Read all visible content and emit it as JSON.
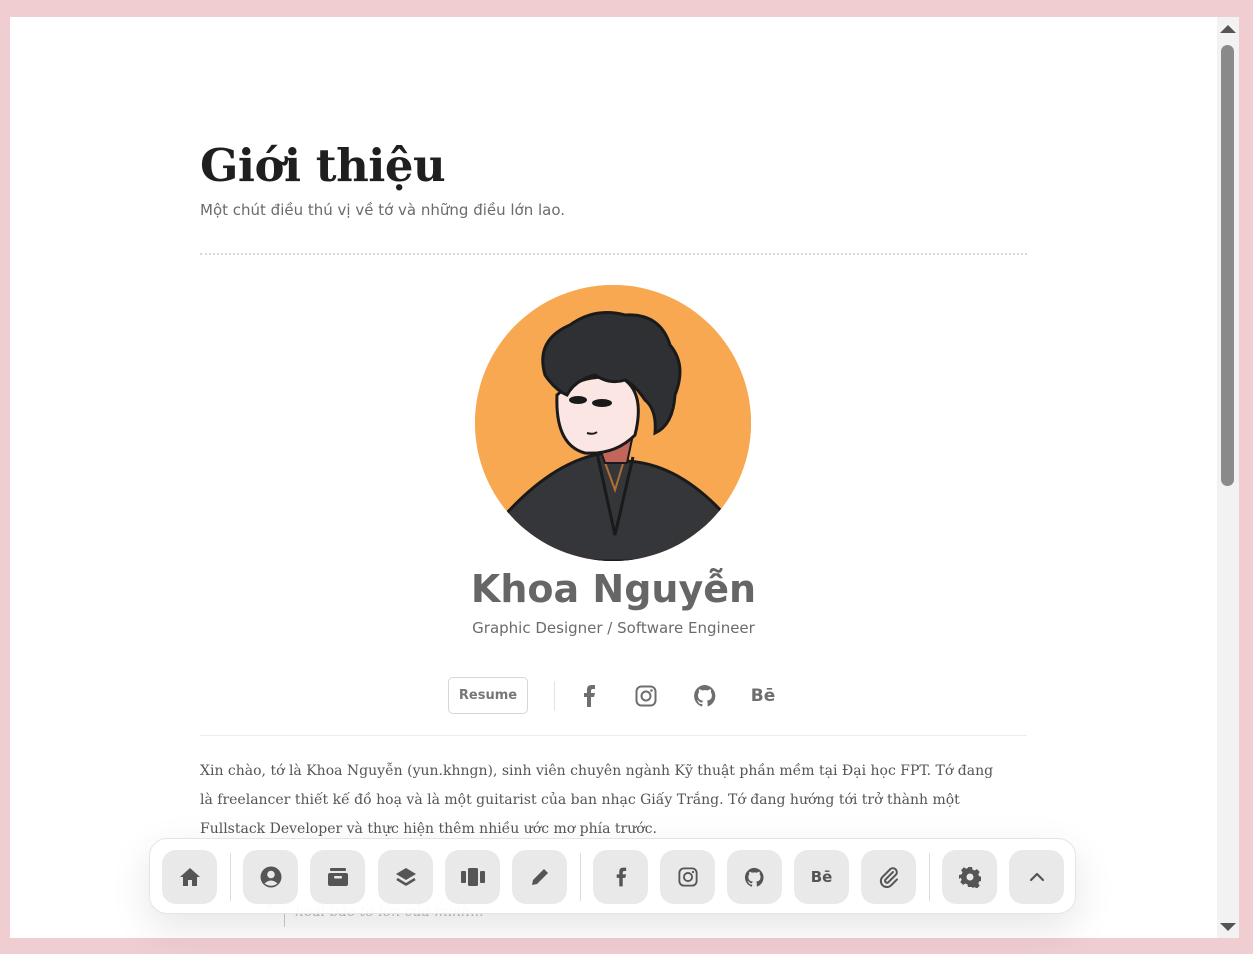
{
  "header": {
    "title": "Giới thiệu",
    "subtitle": "Một chút điều thú vị về tớ và những điều lớn lao."
  },
  "profile": {
    "name": "Khoa Nguyễn",
    "role": "Graphic Designer / Software Engineer",
    "resume_label": "Resume",
    "social": [
      {
        "icon": "facebook-icon"
      },
      {
        "icon": "instagram-icon"
      },
      {
        "icon": "github-icon"
      },
      {
        "icon": "behance-icon",
        "text": "Bē"
      }
    ]
  },
  "intro": {
    "text": "Xin chào, tớ là Khoa Nguyễn (yun.khngn), sinh viên chuyên ngành Kỹ thuật phần mềm tại Đại học FPT. Tớ đang là freelancer thiết kế đồ hoạ và là một guitarist của ban nhạc Giấy Trắng. Tớ đang hướng tới trở thành một Fullstack Developer và thực hiện thêm nhiều ước mơ phía trước.",
    "quote_partial": "hoài bão to lớn của mình..."
  },
  "dock": {
    "items": [
      {
        "icon": "home-icon"
      },
      {
        "icon": "user-icon"
      },
      {
        "icon": "archive-icon"
      },
      {
        "icon": "layers-icon"
      },
      {
        "icon": "columns-icon"
      },
      {
        "icon": "pencil-icon"
      },
      {
        "icon": "facebook-icon"
      },
      {
        "icon": "instagram-icon"
      },
      {
        "icon": "github-icon"
      },
      {
        "icon": "behance-icon",
        "text": "Bē"
      },
      {
        "icon": "paperclip-icon"
      },
      {
        "icon": "gear-icon"
      },
      {
        "icon": "chevron-up-icon"
      }
    ]
  },
  "colors": {
    "page_background": "#f0cdd1",
    "avatar_background": "#f8a850",
    "dock_button": "#e9e9e9"
  }
}
